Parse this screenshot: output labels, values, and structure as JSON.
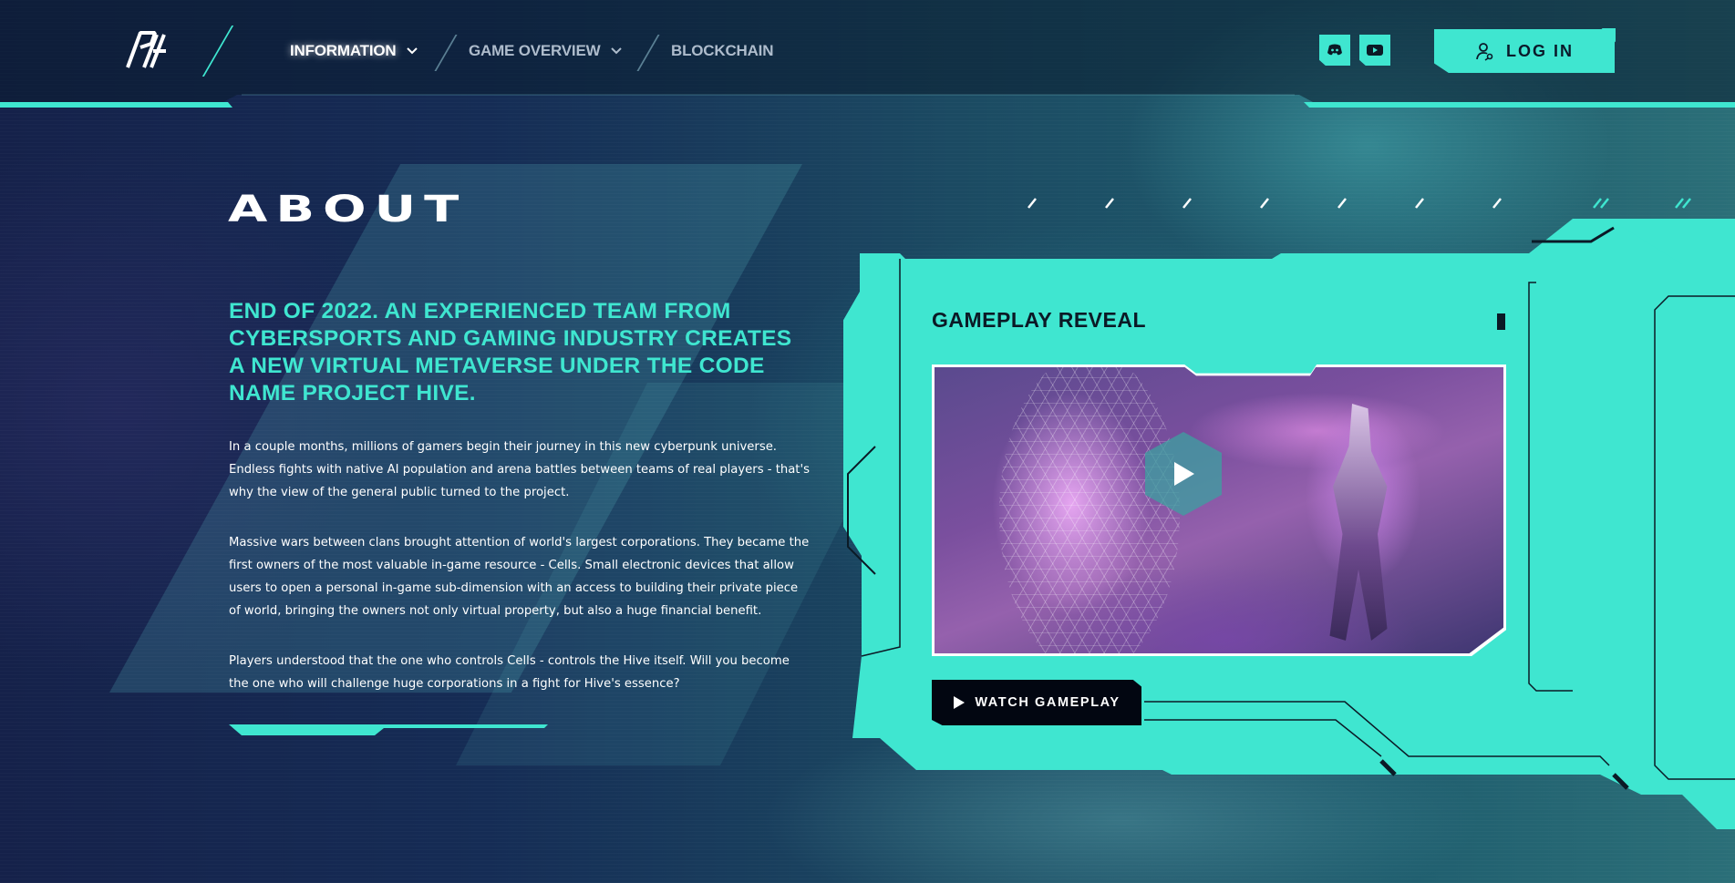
{
  "nav": {
    "items": [
      {
        "label": "INFORMATION",
        "has_dropdown": true,
        "active": true
      },
      {
        "label": "GAME OVERVIEW",
        "has_dropdown": true,
        "active": false
      },
      {
        "label": "BLOCKCHAIN",
        "has_dropdown": false,
        "active": false
      }
    ],
    "social": [
      {
        "icon": "discord-icon"
      },
      {
        "icon": "youtube-icon"
      }
    ],
    "login_label": "LOG IN",
    "login_icon": "user-key-icon"
  },
  "about": {
    "title": "ABOUT",
    "headline": "END OF 2022. AN EXPERIENCED TEAM FROM CYBERSPORTS AND GAMING INDUSTRY CREATES A NEW VIRTUAL METAVERSE UNDER THE CODE NAME PROJECT HIVE.",
    "paragraphs": [
      "In a couple months, millions of gamers begin their journey in this new cyberpunk universe. Endless fights with native AI population and arena battles between teams of real players - that's why the view of the general public turned to the project.",
      "Massive wars between clans brought attention of world's largest corporations. They became the first owners of the most valuable in-game resource - Cells. Small electronic devices that allow users to open a personal in-game sub-dimension with an access to building their private piece of world, bringing the owners not only virtual property, but also a huge financial benefit.",
      "Players understood that the one who controls Cells - controls the Hive itself. Will you become the one who will challenge huge corporations in a fight for Hive's essence?"
    ]
  },
  "gameplay": {
    "title": "GAMEPLAY REVEAL",
    "watch_label": "WATCH GAMEPLAY",
    "play_icon": "play-icon"
  },
  "colors": {
    "accent": "#3fe6d0",
    "dark": "#0b1a26",
    "text": "#ffffff"
  }
}
